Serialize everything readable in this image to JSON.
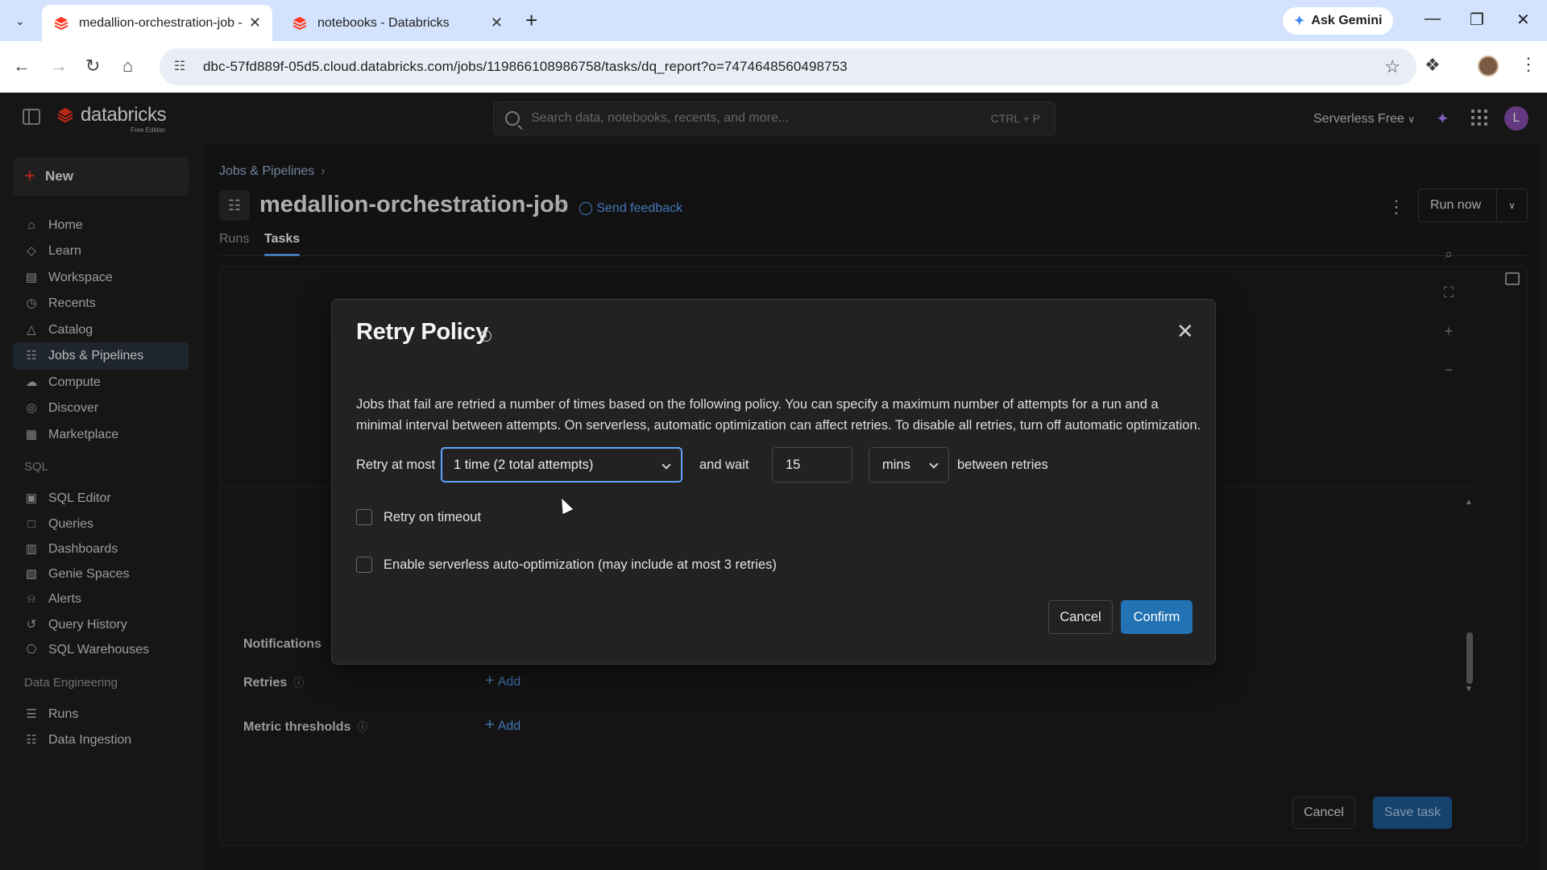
{
  "browser": {
    "tabs": [
      {
        "title": "medallion-orchestration-job - D",
        "active": true
      },
      {
        "title": "notebooks - Databricks",
        "active": false
      }
    ],
    "gemini_label": "Ask Gemini",
    "url": "dbc-57fd889f-05d5.cloud.databricks.com/jobs/119866108986758/tasks/dq_report?o=7474648560498753"
  },
  "app": {
    "logo_text": "databricks",
    "logo_sub": "Free Edition",
    "search_placeholder": "Search data, notebooks, recents, and more...",
    "search_shortcut": "CTRL + P",
    "compute_label": "Serverless Free",
    "avatar_initial": "L",
    "colors": {
      "accent": "#2272b4",
      "brand": "#ff3621",
      "link": "#5ea6ff"
    }
  },
  "sidebar": {
    "new_label": "New",
    "items": [
      {
        "label": "Home",
        "icon": "home-icon"
      },
      {
        "label": "Learn",
        "icon": "learn-icon"
      },
      {
        "label": "Workspace",
        "icon": "workspace-icon"
      },
      {
        "label": "Recents",
        "icon": "clock-icon"
      },
      {
        "label": "Catalog",
        "icon": "catalog-icon"
      },
      {
        "label": "Jobs & Pipelines",
        "icon": "jobs-icon",
        "active": true
      },
      {
        "label": "Compute",
        "icon": "cloud-icon"
      },
      {
        "label": "Discover",
        "icon": "compass-icon"
      },
      {
        "label": "Marketplace",
        "icon": "store-icon"
      }
    ],
    "sql_section": "SQL",
    "sql_items": [
      {
        "label": "SQL Editor",
        "icon": "editor-icon"
      },
      {
        "label": "Queries",
        "icon": "query-icon"
      },
      {
        "label": "Dashboards",
        "icon": "dashboard-icon"
      },
      {
        "label": "Genie Spaces",
        "icon": "genie-icon"
      },
      {
        "label": "Alerts",
        "icon": "bell-icon"
      },
      {
        "label": "Query History",
        "icon": "history-icon"
      },
      {
        "label": "SQL Warehouses",
        "icon": "warehouse-icon"
      }
    ],
    "de_section": "Data Engineering",
    "de_items": [
      {
        "label": "Runs",
        "icon": "runs-icon"
      },
      {
        "label": "Data Ingestion",
        "icon": "ingestion-icon"
      }
    ]
  },
  "job": {
    "breadcrumb": "Jobs & Pipelines",
    "title": "medallion-orchestration-job",
    "send_feedback": "Send feedback",
    "run_now": "Run now",
    "tabs": [
      {
        "label": "Runs"
      },
      {
        "label": "Tasks",
        "active": true
      }
    ],
    "notifications_label": "Notifications",
    "retries_label": "Retries",
    "metric_thresholds_label": "Metric thresholds",
    "add_label": "Add",
    "cancel_label": "Cancel",
    "save_task_label": "Save task"
  },
  "modal": {
    "title": "Retry Policy",
    "description": "Jobs that fail are retried a number of times based on the following policy. You can specify a maximum number of attempts for a run and a minimal interval between attempts. On serverless, automatic optimization can affect retries. To disable all retries, turn off automatic optimization.",
    "retry_at_most_label": "Retry at most",
    "retry_select_value": "1 time (2 total attempts)",
    "and_wait_label": "and wait",
    "wait_value": "15",
    "unit_value": "mins",
    "between_label": "between retries",
    "retry_on_timeout_label": "Retry on timeout",
    "retry_on_timeout_checked": false,
    "auto_opt_label": "Enable serverless auto-optimization (may include at most 3 retries)",
    "auto_opt_checked": false,
    "cancel_label": "Cancel",
    "confirm_label": "Confirm"
  }
}
